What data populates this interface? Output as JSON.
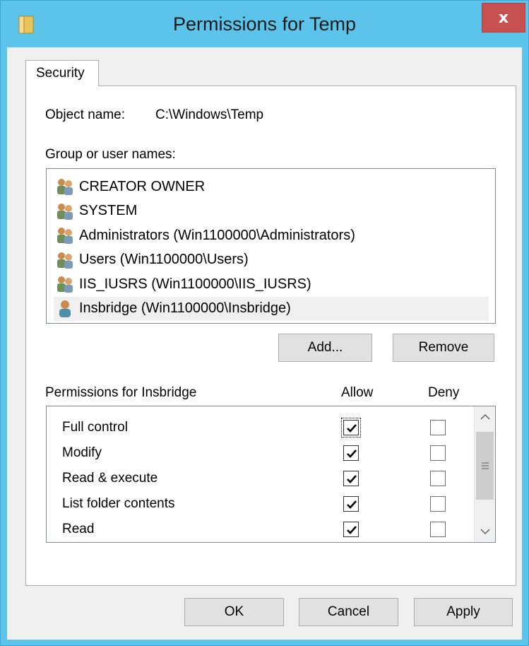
{
  "window": {
    "title": "Permissions for Temp",
    "close_glyph": "x"
  },
  "tabs": [
    {
      "label": "Security"
    }
  ],
  "object_name": {
    "label": "Object name:",
    "value": "C:\\Windows\\Temp"
  },
  "groups": {
    "label": "Group or user names:",
    "items": [
      {
        "name": "CREATOR OWNER",
        "icon": "group-icon"
      },
      {
        "name": "SYSTEM",
        "icon": "group-icon"
      },
      {
        "name": "Administrators (Win1100000\\Administrators)",
        "icon": "group-icon"
      },
      {
        "name": "Users (Win1100000\\Users)",
        "icon": "group-icon"
      },
      {
        "name": "IIS_IUSRS (Win1100000\\IIS_IUSRS)",
        "icon": "group-icon"
      },
      {
        "name": "Insbridge (Win1100000\\Insbridge)",
        "icon": "user-icon",
        "selected": true
      }
    ],
    "add_label": "Add...",
    "remove_label": "Remove"
  },
  "permissions": {
    "label": "Permissions for Insbridge",
    "allow_header": "Allow",
    "deny_header": "Deny",
    "rows": [
      {
        "name": "Full control",
        "allow": true,
        "deny": false
      },
      {
        "name": "Modify",
        "allow": true,
        "deny": false
      },
      {
        "name": "Read & execute",
        "allow": true,
        "deny": false
      },
      {
        "name": "List folder contents",
        "allow": true,
        "deny": false
      },
      {
        "name": "Read",
        "allow": true,
        "deny": false
      }
    ]
  },
  "footer": {
    "ok_label": "OK",
    "cancel_label": "Cancel",
    "apply_label": "Apply"
  },
  "colors": {
    "titlebar": "#5cc3ea",
    "close": "#c75050",
    "selection": "#f0f0f0"
  }
}
